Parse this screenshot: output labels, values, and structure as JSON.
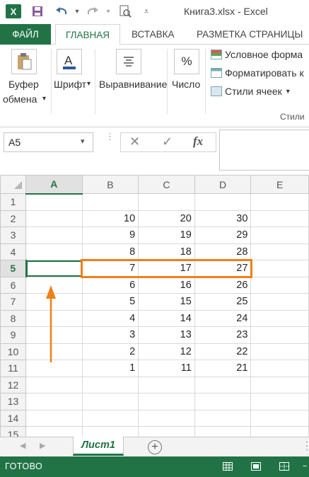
{
  "window": {
    "title": "Книга3.xlsx - Excel"
  },
  "tabs": [
    {
      "label": "ФАЙЛ"
    },
    {
      "label": "ГЛАВНАЯ"
    },
    {
      "label": "ВСТАВКА"
    },
    {
      "label": "РАЗМЕТКА СТРАНИЦЫ"
    }
  ],
  "ribbon": {
    "clipboard_line1": "Буфер",
    "clipboard_line2": "обмена",
    "font": "Шрифт",
    "alignment": "Выравнивание",
    "number": "Число",
    "number_glyph": "%",
    "conditional": "Условное форма",
    "format_table": "Форматировать к",
    "cell_styles": "Стили ячеек",
    "styles_group": "Стили"
  },
  "formula_bar": {
    "name_box": "A5",
    "fx": "fx",
    "value": ""
  },
  "columns": [
    "A",
    "B",
    "C",
    "D",
    "E"
  ],
  "rows": [
    {
      "n": "1",
      "a": "",
      "b": "",
      "c": "",
      "d": ""
    },
    {
      "n": "2",
      "a": "",
      "b": "10",
      "c": "20",
      "d": "30"
    },
    {
      "n": "3",
      "a": "",
      "b": "9",
      "c": "19",
      "d": "29"
    },
    {
      "n": "4",
      "a": "",
      "b": "8",
      "c": "18",
      "d": "28"
    },
    {
      "n": "5",
      "a": "",
      "b": "7",
      "c": "17",
      "d": "27"
    },
    {
      "n": "6",
      "a": "",
      "b": "6",
      "c": "16",
      "d": "26"
    },
    {
      "n": "7",
      "a": "",
      "b": "5",
      "c": "15",
      "d": "25"
    },
    {
      "n": "8",
      "a": "",
      "b": "4",
      "c": "14",
      "d": "24"
    },
    {
      "n": "9",
      "a": "",
      "b": "3",
      "c": "13",
      "d": "23"
    },
    {
      "n": "10",
      "a": "",
      "b": "2",
      "c": "12",
      "d": "22"
    },
    {
      "n": "11",
      "a": "",
      "b": "1",
      "c": "11",
      "d": "21"
    },
    {
      "n": "12",
      "a": "",
      "b": "",
      "c": "",
      "d": ""
    },
    {
      "n": "13",
      "a": "",
      "b": "",
      "c": "",
      "d": ""
    },
    {
      "n": "14",
      "a": "",
      "b": "",
      "c": "",
      "d": ""
    },
    {
      "n": "15",
      "a": "",
      "b": "",
      "c": "",
      "d": ""
    }
  ],
  "active_cell": "A5",
  "sheets": {
    "active": "Лист1"
  },
  "status": {
    "text": "ГОТОВО"
  },
  "colors": {
    "accent": "#217346",
    "highlight": "#f07f17"
  }
}
